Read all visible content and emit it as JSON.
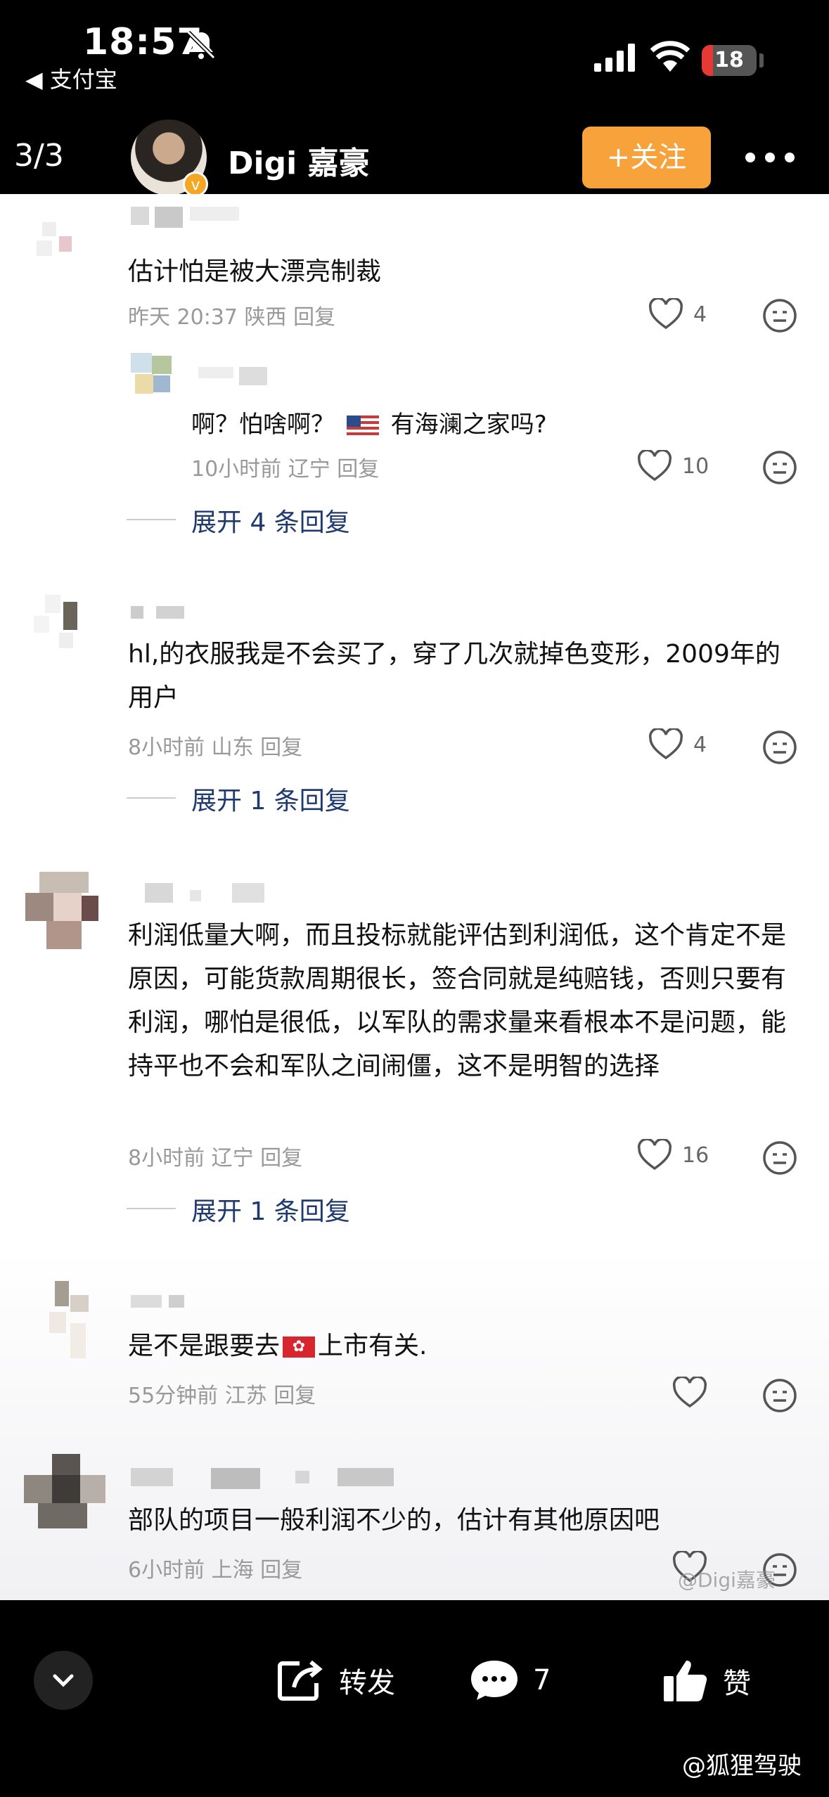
{
  "status": {
    "time": "18:57",
    "back_app": "◀ 支付宝",
    "battery": "18"
  },
  "header": {
    "pager": "3/3",
    "name": "Digi 嘉豪",
    "follow": "+关注",
    "colors": {
      "follow_bg": "#f7a23b"
    }
  },
  "comments": [
    {
      "text": "估计怕是被大漂亮制裁",
      "meta": "昨天 20:37 陕西 回复",
      "likes": "4"
    },
    {
      "text": "hl,的衣服我是不会买了，穿了几次就掉色变形，2009年的用户",
      "meta": "8小时前 山东 回复",
      "likes": "4",
      "expand": "展开 1 条回复"
    },
    {
      "text": "利润低量大啊，而且投标就能评估到利润低，这个肯定不是原因，可能货款周期很长，签合同就是纯赔钱，否则只要有利润，哪怕是很低，以军队的需求量来看根本不是问题，能持平也不会和军队之间闹僵，这不是明智的选择",
      "meta": "8小时前 辽宁 回复",
      "likes": "16",
      "expand": "展开 1 条回复"
    },
    {
      "text_a": "是不是跟要去",
      "text_b": "上市有关.",
      "meta": "55分钟前 江苏 回复",
      "likes": ""
    },
    {
      "text": "部队的项目一般利润不少的，估计有其他原因吧",
      "meta": "6小时前 上海 回复",
      "likes": ""
    }
  ],
  "reply": {
    "text_a": "啊？怕啥啊？",
    "text_b": "有海澜之家吗?",
    "meta": "10小时前 辽宁 回复",
    "likes": "10",
    "expand": "展开 4 条回复"
  },
  "bottom": {
    "repost": "转发",
    "comments": "7",
    "like": "赞"
  },
  "watermarks": {
    "inner": "@Digi嘉豪",
    "outer": "@狐狸驾驶"
  }
}
